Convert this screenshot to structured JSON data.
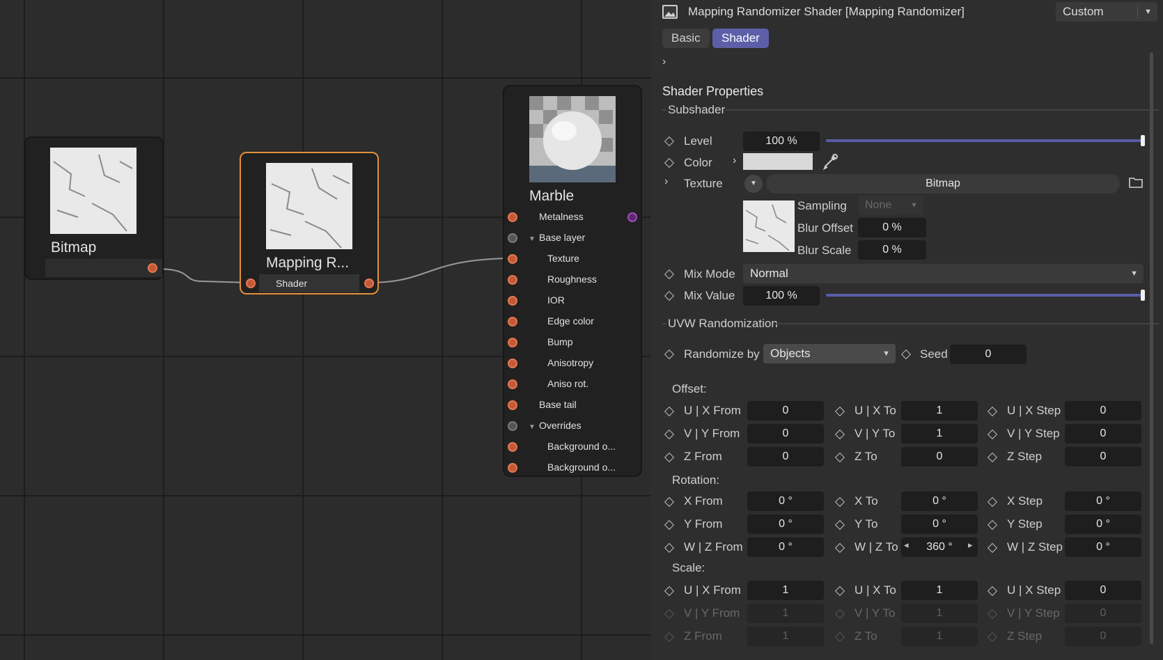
{
  "editor": {
    "nodes": {
      "bitmap": {
        "title": "Bitmap"
      },
      "mapping": {
        "title": "Mapping R...",
        "port_label": "Shader"
      },
      "marble": {
        "title": "Marble",
        "ports": [
          "Metalness",
          "Base layer",
          "Texture",
          "Roughness",
          "IOR",
          "Edge color",
          "Bump",
          "Anisotropy",
          "Aniso rot.",
          "Base tail",
          "Overrides",
          "Background o...",
          "Background o..."
        ]
      }
    }
  },
  "panel": {
    "title": "Mapping Randomizer Shader [Mapping Randomizer]",
    "mode_dropdown": "Custom",
    "tabs": {
      "basic": "Basic",
      "shader": "Shader"
    },
    "section_title": "Shader Properties",
    "subshader": {
      "group_label": "Subshader",
      "level_label": "Level",
      "level_value": "100 %",
      "level_fraction": 1.0,
      "color_label": "Color",
      "texture_label": "Texture",
      "texture_value": "Bitmap",
      "sampling_label": "Sampling",
      "sampling_value": "None",
      "blur_offset_label": "Blur Offset",
      "blur_offset_value": "0 %",
      "blur_scale_label": "Blur Scale",
      "blur_scale_value": "0 %",
      "mix_mode_label": "Mix Mode",
      "mix_mode_value": "Normal",
      "mix_value_label": "Mix Value",
      "mix_value_value": "100 %",
      "mix_value_fraction": 1.0
    },
    "uvw": {
      "group_label": "UVW Randomization",
      "randomize_by_label": "Randomize by",
      "randomize_by_value": "Objects",
      "seed_label": "Seed",
      "seed_value": "0",
      "offset_label": "Offset:",
      "rotation_label": "Rotation:",
      "scale_label": "Scale:",
      "offset_rows": [
        [
          {
            "label": "U | X From",
            "value": "0"
          },
          {
            "label": "U | X To",
            "value": "1"
          },
          {
            "label": "U | X Step",
            "value": "0"
          }
        ],
        [
          {
            "label": "V | Y From",
            "value": "0"
          },
          {
            "label": "V | Y To",
            "value": "1"
          },
          {
            "label": "V | Y Step",
            "value": "0"
          }
        ],
        [
          {
            "label": "Z From",
            "value": "0"
          },
          {
            "label": "Z To",
            "value": "0"
          },
          {
            "label": "Z Step",
            "value": "0"
          }
        ]
      ],
      "rotation_rows": [
        [
          {
            "label": "X From",
            "value": "0 °"
          },
          {
            "label": "X To",
            "value": "0 °"
          },
          {
            "label": "X Step",
            "value": "0 °"
          }
        ],
        [
          {
            "label": "Y From",
            "value": "0 °"
          },
          {
            "label": "Y To",
            "value": "0 °"
          },
          {
            "label": "Y Step",
            "value": "0 °"
          }
        ],
        [
          {
            "label": "W | Z From",
            "value": "0 °"
          },
          {
            "label": "W | Z To",
            "value": "360 °"
          },
          {
            "label": "W | Z Step",
            "value": "0 °"
          }
        ]
      ],
      "scale_rows": [
        [
          {
            "label": "U | X From",
            "value": "1"
          },
          {
            "label": "U | X To",
            "value": "1"
          },
          {
            "label": "U | X Step",
            "value": "0"
          }
        ],
        [
          {
            "label": "V | Y From",
            "value": "1"
          },
          {
            "label": "V | Y To",
            "value": "1"
          },
          {
            "label": "V | Y Step",
            "value": "0"
          }
        ],
        [
          {
            "label": "Z From",
            "value": "1"
          },
          {
            "label": "Z To",
            "value": "1"
          },
          {
            "label": "Z Step",
            "value": "0"
          }
        ]
      ]
    }
  },
  "colors": {
    "accent": "#5c5fa8",
    "selection": "#e0913b",
    "port_orange": "#c25a3a",
    "port_purple": "#a24dc0",
    "color_swatch": "#d9d9d9"
  }
}
